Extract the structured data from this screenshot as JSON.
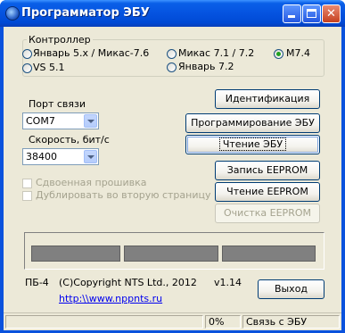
{
  "window": {
    "title": "Программатор ЭБУ"
  },
  "controller": {
    "group_label": "Контроллер",
    "options": [
      {
        "label": "Январь 5.x / Микас-7.6",
        "checked": false
      },
      {
        "label": "Микас 7.1 / 7.2",
        "checked": false
      },
      {
        "label": "M7.4",
        "checked": true
      },
      {
        "label": "VS 5.1",
        "checked": false
      },
      {
        "label": "Январь 7.2",
        "checked": false
      }
    ]
  },
  "port": {
    "label": "Порт связи",
    "value": "COM7"
  },
  "speed": {
    "label": "Скорость, бит/с",
    "value": "38400"
  },
  "options": {
    "double_flash": "Сдвоенная прошивка",
    "duplicate_page": "Дублировать во вторую страницу"
  },
  "buttons": {
    "identify": "Идентификация",
    "program": "Программирование ЭБУ",
    "read_ecu": "Чтение ЭБУ",
    "write_eeprom": "Запись EEPROM",
    "read_eeprom": "Чтение EEPROM",
    "clear_eeprom": "Очистка EEPROM",
    "exit": "Выход"
  },
  "footer": {
    "model": "ПБ-4",
    "copyright": "(C)Copyright NTS Ltd., 2012",
    "version": "v1.14",
    "link": "http:\\\\www.nppnts.ru"
  },
  "status": {
    "left": "",
    "percent": "0%",
    "message": "Связь с ЭБУ"
  }
}
